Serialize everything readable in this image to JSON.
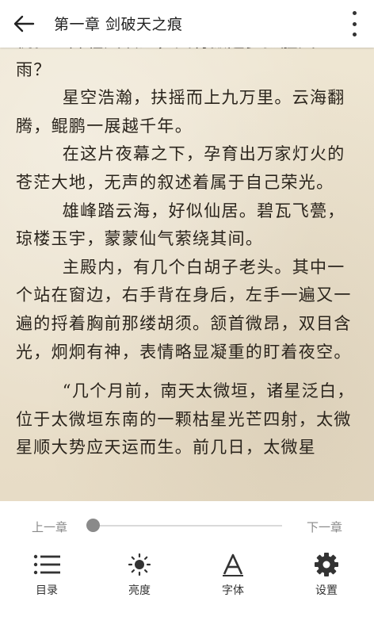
{
  "header": {
    "title": "第一章 剑破天之痕",
    "back_icon": "back-arrow-icon",
    "more_icon": "more-vertical-icon"
  },
  "content": {
    "paragraphs": [
      "机。一阵轻风吹过，又将掀起多少腥风血雨？",
      "星空浩瀚，扶摇而上九万里。云海翻腾，鲲鹏一展越千年。",
      "在这片夜幕之下，孕育出万家灯火的苍茫大地，无声的叙述着属于自己荣光。",
      "雄峰踏云海，好似仙居。碧瓦飞甍，琼楼玉宇，蒙蒙仙气萦绕其间。",
      "主殿内，有几个白胡子老头。其中一个站在窗边，右手背在身后，左手一遍又一遍的捋着胸前那缕胡须。颔首微昂，双目含光，炯炯有神，表情略显凝重的盯着夜空。",
      "“几个月前，南天太微垣，诸星泛白，位于太微垣东南的一颗枯星光芒四射，太微星顺大势应天运而生。前几日，太微星"
    ]
  },
  "controls": {
    "prev_label": "上一章",
    "next_label": "下一章",
    "progress": 0.0
  },
  "toolbar": {
    "items": [
      {
        "label": "目录",
        "icon": "list-icon"
      },
      {
        "label": "亮度",
        "icon": "brightness-icon"
      },
      {
        "label": "字体",
        "icon": "font-icon"
      },
      {
        "label": "设置",
        "icon": "gear-icon"
      }
    ]
  }
}
